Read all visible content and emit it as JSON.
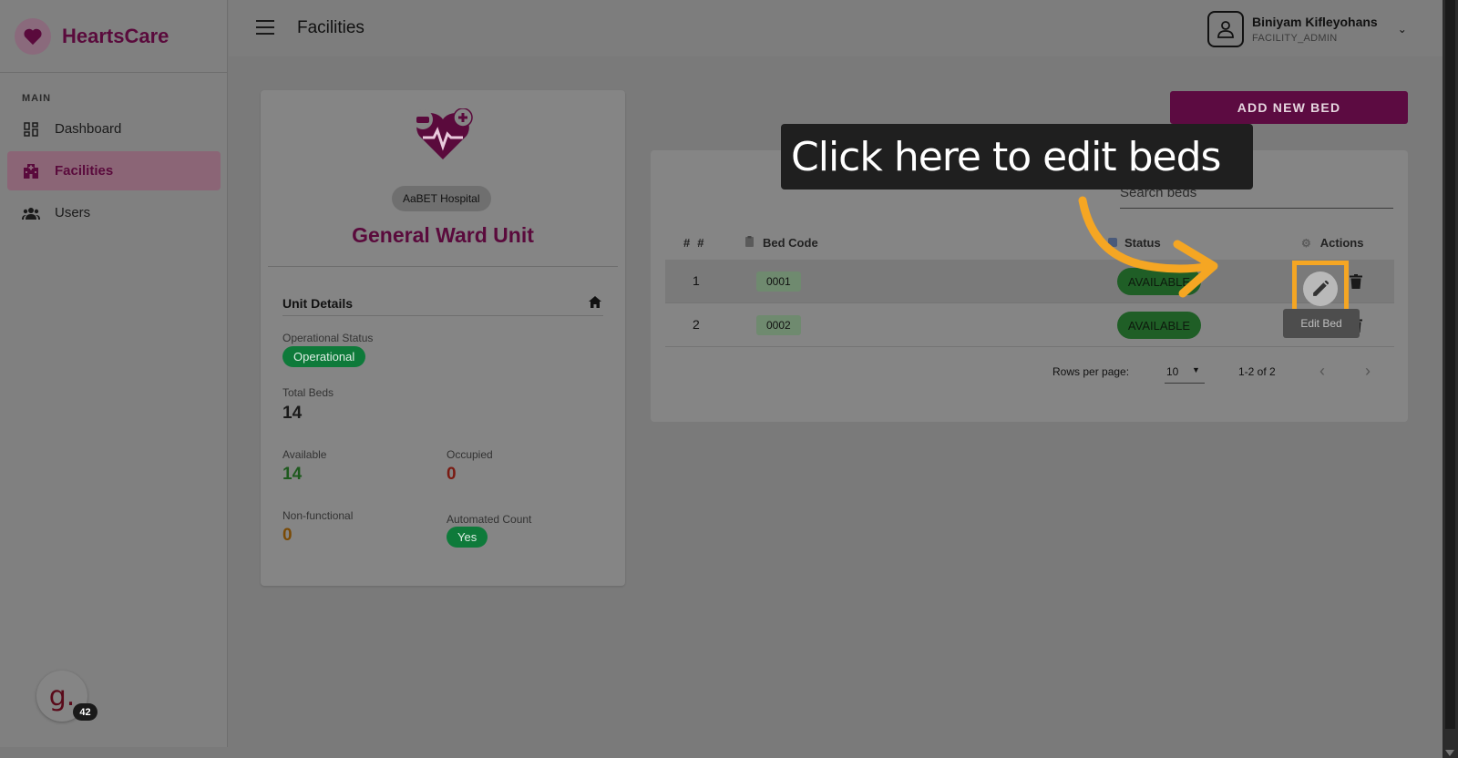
{
  "brand": {
    "name": "HeartsCare",
    "icon": "heart-icon",
    "color": "#5a0a3c"
  },
  "sidebar": {
    "section": "MAIN",
    "items": [
      {
        "label": "Dashboard",
        "icon": "dashboard-icon",
        "active": false
      },
      {
        "label": "Facilities",
        "icon": "hospital-icon",
        "active": true
      },
      {
        "label": "Users",
        "icon": "users-icon",
        "active": false
      }
    ]
  },
  "header": {
    "title": "Facilities",
    "user": {
      "name": "Biniyam Kifleyohans",
      "role": "FACILITY_ADMIN"
    }
  },
  "unit": {
    "hospital": "AaBET Hospital",
    "title": "General Ward Unit",
    "details_title": "Unit Details",
    "operational_status_label": "Operational Status",
    "operational_status": "Operational",
    "total_beds_label": "Total Beds",
    "total_beds": "14",
    "available_label": "Available",
    "available": "14",
    "occupied_label": "Occupied",
    "occupied": "0",
    "nonfunctional_label": "Non-functional",
    "nonfunctional": "0",
    "automated_label": "Automated Count",
    "automated": "Yes"
  },
  "beds": {
    "add_label": "ADD NEW BED",
    "search_placeholder": "Search beds",
    "columns": {
      "num": "#",
      "code": "Bed Code",
      "status": "Status",
      "actions": "Actions"
    },
    "rows": [
      {
        "num": "1",
        "code": "0001",
        "status": "AVAILABLE"
      },
      {
        "num": "2",
        "code": "0002",
        "status": "AVAILABLE"
      }
    ],
    "rows_per_page_label": "Rows per page:",
    "rows_per_page": "10",
    "range": "1-2 of 2"
  },
  "guide": {
    "callout": "Click here to edit beds",
    "tooltip": "Edit Bed"
  },
  "chat": {
    "glyph": "g.",
    "count": "42"
  },
  "colors": {
    "accent": "#5c0b41",
    "success": "#0e7a3a",
    "highlight": "#f5a623"
  }
}
